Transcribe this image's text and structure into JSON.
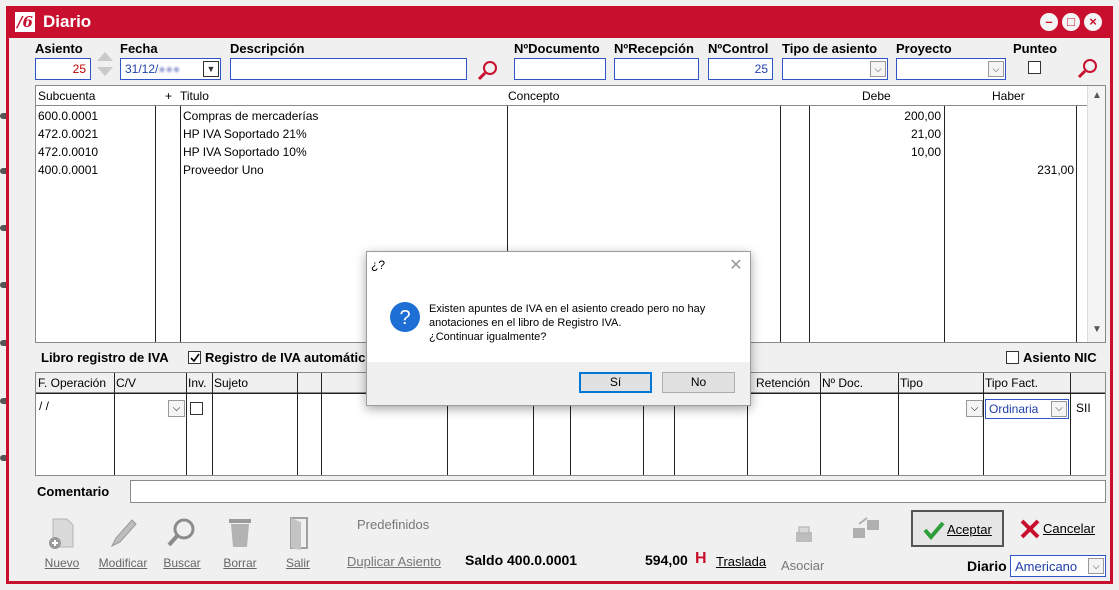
{
  "window": {
    "title": "Diario",
    "minimize": "–",
    "maximize": "□",
    "close": "×"
  },
  "header": {
    "asiento_label": "Asiento",
    "asiento_value": "25",
    "fecha_label": "Fecha",
    "fecha_value": "31/12/",
    "descripcion_label": "Descripción",
    "descripcion_value": "",
    "ndocumento_label": "NºDocumento",
    "nrecepcion_label": "NºRecepción",
    "ncontrol_label": "NºControl",
    "ncontrol_value": "25",
    "tipo_asiento_label": "Tipo de asiento",
    "proyecto_label": "Proyecto",
    "punteo_label": "Punteo"
  },
  "entries_grid": {
    "columns": {
      "subcuenta": "Subcuenta",
      "plus": "+",
      "titulo": "Titulo",
      "concepto": "Concepto",
      "debe": "Debe",
      "haber": "Haber"
    },
    "rows": [
      {
        "subcuenta": "600.0.0001",
        "titulo": "Compras de mercaderías",
        "debe": "200,00",
        "haber": ""
      },
      {
        "subcuenta": "472.0.0021",
        "titulo": "HP IVA Soportado 21%",
        "debe": "21,00",
        "haber": ""
      },
      {
        "subcuenta": "472.0.0010",
        "titulo": "HP IVA Soportado 10%",
        "debe": "10,00",
        "haber": ""
      },
      {
        "subcuenta": "400.0.0001",
        "titulo": "Proveedor Uno",
        "debe": "",
        "haber": "231,00"
      }
    ]
  },
  "iva": {
    "section_label": "Libro registro de IVA",
    "auto_label": "Registro de IVA automátic",
    "nic_label": "Asiento NIC",
    "columns": {
      "f_operacion": "F. Operación",
      "cv": "C/V",
      "inv": "Inv.",
      "sujeto": "Sujeto",
      "retencion": "Retención",
      "n_doc": "Nº Doc.",
      "tipo": "Tipo",
      "tipo_fact": "Tipo Fact."
    },
    "row": {
      "f_operacion": "/ /",
      "tipo_fact": "Ordinaria",
      "sii": "SII"
    }
  },
  "comentario_label": "Comentario",
  "toolbar": {
    "nuevo": "Nuevo",
    "modificar": "Modificar",
    "buscar": "Buscar",
    "borrar": "Borrar",
    "salir": "Salir",
    "predefinidos": "Predefinidos",
    "duplicar": "Duplicar Asiento",
    "saldo_label": "Saldo 400.0.0001",
    "saldo_value": "594,00",
    "saldo_flag": "H",
    "traslada": "Traslada",
    "asociar": "Asociar",
    "aceptar": "Aceptar",
    "cancelar": "Cancelar",
    "diario_label": "Diario",
    "diario_value": "Americano"
  },
  "dialog": {
    "title": "¿?",
    "message_line1": "Existen apuntes de IVA en el asiento creado pero no hay",
    "message_line2": "anotaciones en el libro de Registro IVA.",
    "message_line3": "¿Continuar igualmente?",
    "yes": "Sí",
    "no": "No"
  },
  "colors": {
    "brand": "#c8102e",
    "field_border": "#2f55c9",
    "dialog_accent": "#0078d7"
  }
}
